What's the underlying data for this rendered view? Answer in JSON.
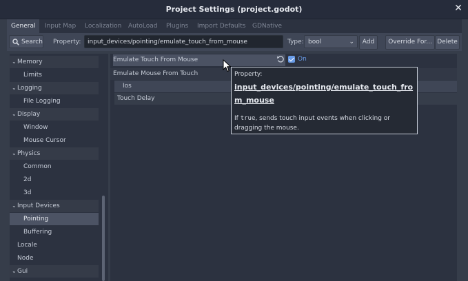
{
  "window": {
    "title": "Project Settings (project.godot)",
    "close_glyph": "✕"
  },
  "tabs": [
    "General",
    "Input Map",
    "Localization",
    "AutoLoad",
    "Plugins",
    "Import Defaults",
    "GDNative"
  ],
  "toolbar": {
    "search_label": "Search",
    "property_label": "Property:",
    "property_value": "input_devices/pointing/emulate_touch_from_mouse",
    "type_label": "Type:",
    "type_value": "bool",
    "add_label": "Add",
    "override_label": "Override For...",
    "delete_label": "Delete"
  },
  "sidebar": {
    "items": [
      {
        "label": "Memory",
        "kind": "section"
      },
      {
        "label": "Limits",
        "kind": "child"
      },
      {
        "label": "Logging",
        "kind": "section"
      },
      {
        "label": "File Logging",
        "kind": "child"
      },
      {
        "label": "Display",
        "kind": "section"
      },
      {
        "label": "Window",
        "kind": "child"
      },
      {
        "label": "Mouse Cursor",
        "kind": "child"
      },
      {
        "label": "Physics",
        "kind": "section"
      },
      {
        "label": "Common",
        "kind": "child"
      },
      {
        "label": "2d",
        "kind": "child"
      },
      {
        "label": "3d",
        "kind": "child"
      },
      {
        "label": "Input Devices",
        "kind": "section"
      },
      {
        "label": "Pointing",
        "kind": "child",
        "selected": true
      },
      {
        "label": "Buffering",
        "kind": "child"
      },
      {
        "label": "Locale",
        "kind": "leaf"
      },
      {
        "label": "Node",
        "kind": "leaf"
      },
      {
        "label": "Gui",
        "kind": "section"
      }
    ]
  },
  "properties": {
    "emulate_touch": "Emulate Touch From Mouse",
    "emulate_touch_value": "On",
    "emulate_mouse": "Emulate Mouse From Touch",
    "ios": "Ios",
    "touch_delay": "Touch Delay"
  },
  "tooltip": {
    "label": "Property:",
    "name": "input_devices/pointing/emulate_touch_from_mouse",
    "desc_prefix": "If ",
    "desc_code": "true",
    "desc_suffix": ", sends touch input events when clicking or dragging the mouse."
  },
  "colors": {
    "accent": "#699ce8",
    "background": "#363d4a",
    "panel": "#2c3240"
  }
}
